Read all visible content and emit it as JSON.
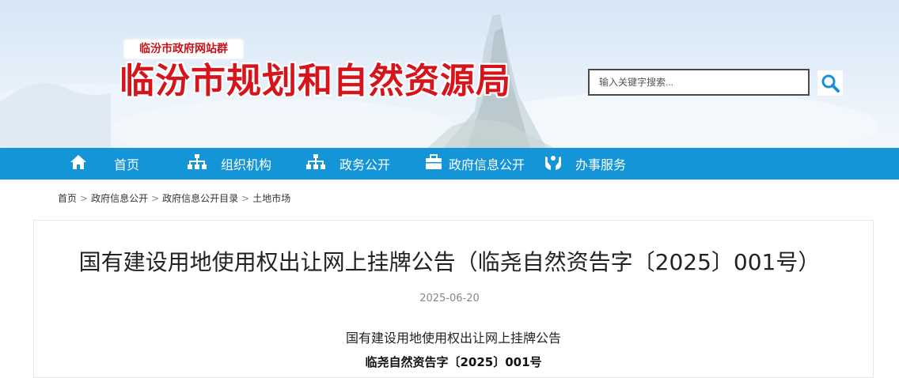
{
  "header": {
    "group_label": "临汾市政府网站群",
    "site_title": "临汾市规划和自然资源局",
    "search": {
      "placeholder": "输入关键字搜索..."
    }
  },
  "nav": {
    "items": [
      {
        "label": "首页",
        "icon": "home-icon"
      },
      {
        "label": "组织机构",
        "icon": "org-chart-icon"
      },
      {
        "label": "政务公开",
        "icon": "org-chart-icon"
      },
      {
        "label": "政府信息公开",
        "icon": "briefcase-icon"
      },
      {
        "label": "办事服务",
        "icon": "hands-service-icon"
      }
    ]
  },
  "breadcrumb": {
    "items": [
      "首页",
      "政府信息公开",
      "政府信息公开目录",
      "土地市场"
    ],
    "separator": ">"
  },
  "article": {
    "title": "国有建设用地使用权出让网上挂牌公告（临尧自然资告字〔2025〕001号）",
    "date": "2025-06-20",
    "body_heading": "国有建设用地使用权出让网上挂牌公告",
    "body_doc_number": "临尧自然资告字〔2025〕001号"
  },
  "colors": {
    "nav_bg": "#1495d8",
    "title_red": "#d5141c",
    "search_icon": "#1a8fd8"
  }
}
